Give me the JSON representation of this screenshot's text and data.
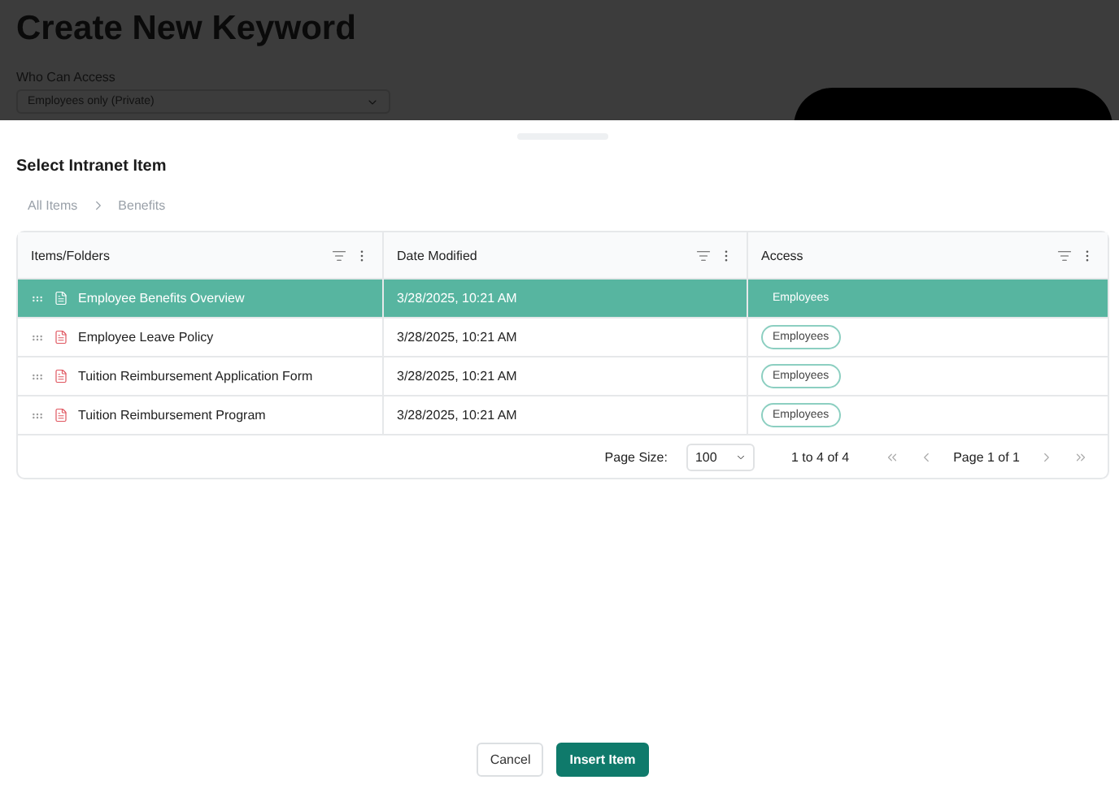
{
  "background_page": {
    "title": "Create New Keyword",
    "access_label": "Who Can Access",
    "access_select": {
      "value": "Employees only (Private)"
    }
  },
  "dialog": {
    "title": "Select Intranet Item",
    "breadcrumb": [
      {
        "label": "All Items"
      },
      {
        "label": "Benefits"
      }
    ],
    "table": {
      "columns": [
        {
          "label": "Items/Folders"
        },
        {
          "label": "Date Modified"
        },
        {
          "label": "Access"
        }
      ],
      "rows": [
        {
          "name": "Employee Benefits Overview",
          "date": "3/28/2025, 10:21 AM",
          "access": "Employees",
          "selected": true
        },
        {
          "name": "Employee Leave Policy",
          "date": "3/28/2025, 10:21 AM",
          "access": "Employees",
          "selected": false
        },
        {
          "name": "Tuition Reimbursement Application Form",
          "date": "3/28/2025, 10:21 AM",
          "access": "Employees",
          "selected": false
        },
        {
          "name": "Tuition Reimbursement Program",
          "date": "3/28/2025, 10:21 AM",
          "access": "Employees",
          "selected": false
        }
      ]
    },
    "pagination": {
      "page_size_label": "Page Size:",
      "page_size": "100",
      "range": "1 to 4 of 4",
      "page": "Page 1 of 1"
    },
    "buttons": [
      {
        "label": "Cancel",
        "kind": "secondary"
      },
      {
        "label": "Insert Item",
        "kind": "primary"
      }
    ]
  }
}
